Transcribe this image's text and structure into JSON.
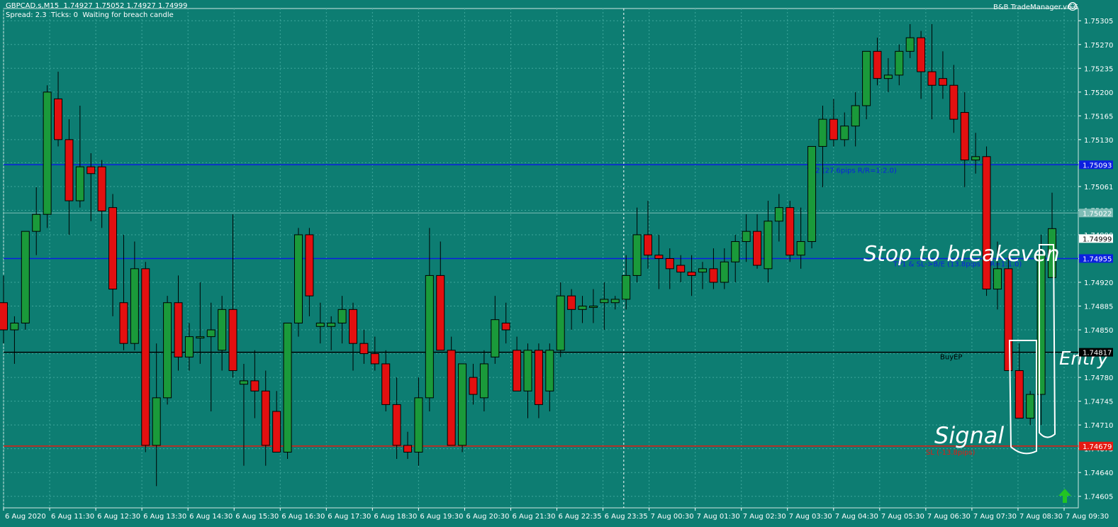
{
  "header": {
    "symbol_line": "GBPCAD.s,M15  1.74927 1.75052 1.74927 1.74999",
    "status_line": "Spread: 2.3  Ticks: 0  Waiting for breach candle",
    "ea_name": "B&B TradeManager.v6.6"
  },
  "colors": {
    "background": "#0d7d72",
    "bull_candle": "#1a9a3a",
    "bear_candle": "#e31010",
    "grid": "#3fa79c",
    "tp_line": "#0b1fe0",
    "sl_line": "#e41a12",
    "entry_line": "#000000",
    "annotation": "#ffffff"
  },
  "chart_data": {
    "type": "candlestick",
    "symbol": "GBPCAD.s",
    "timeframe": "M15",
    "ylim": [
      1.74605,
      1.75305
    ],
    "y_ticks": [
      "1.75305",
      "1.75270",
      "1.75235",
      "1.75200",
      "1.75165",
      "1.75130",
      "1.75096",
      "1.75061",
      "1.75026",
      "1.74990",
      "1.74955",
      "1.74920",
      "1.74885",
      "1.74850",
      "1.74815",
      "1.74780",
      "1.74745",
      "1.74710",
      "1.74675",
      "1.74640",
      "1.74605"
    ],
    "x_ticks": [
      "6 Aug 2020",
      "6 Aug 11:30",
      "6 Aug 12:30",
      "6 Aug 13:30",
      "6 Aug 14:30",
      "6 Aug 15:30",
      "6 Aug 16:30",
      "6 Aug 17:30",
      "6 Aug 18:30",
      "6 Aug 19:30",
      "6 Aug 20:30",
      "6 Aug 21:30",
      "6 Aug 22:35",
      "6 Aug 23:35",
      "7 Aug 00:30",
      "7 Aug 01:30",
      "7 Aug 02:30",
      "7 Aug 03:30",
      "7 Aug 04:30",
      "7 Aug 05:30",
      "7 Aug 06:30",
      "7 Aug 07:30",
      "7 Aug 08:30",
      "7 Aug 09:30"
    ],
    "candles": [
      {
        "o": 1.7489,
        "h": 1.7493,
        "l": 1.7483,
        "c": 1.7485
      },
      {
        "o": 1.7485,
        "h": 1.7487,
        "l": 1.748,
        "c": 1.7486
      },
      {
        "o": 1.7486,
        "h": 1.7495,
        "l": 1.7485,
        "c": 1.74995
      },
      {
        "o": 1.74995,
        "h": 1.7506,
        "l": 1.7496,
        "c": 1.7502
      },
      {
        "o": 1.7502,
        "h": 1.7521,
        "l": 1.75,
        "c": 1.752
      },
      {
        "o": 1.7519,
        "h": 1.7523,
        "l": 1.7512,
        "c": 1.7513
      },
      {
        "o": 1.7513,
        "h": 1.7516,
        "l": 1.7499,
        "c": 1.7504
      },
      {
        "o": 1.7504,
        "h": 1.7518,
        "l": 1.7503,
        "c": 1.7509
      },
      {
        "o": 1.7509,
        "h": 1.7511,
        "l": 1.7501,
        "c": 1.7508
      },
      {
        "o": 1.7509,
        "h": 1.751,
        "l": 1.75,
        "c": 1.75025
      },
      {
        "o": 1.7503,
        "h": 1.7505,
        "l": 1.7487,
        "c": 1.7491
      },
      {
        "o": 1.7489,
        "h": 1.7499,
        "l": 1.7482,
        "c": 1.7483
      },
      {
        "o": 1.7483,
        "h": 1.7498,
        "l": 1.7482,
        "c": 1.7494
      },
      {
        "o": 1.7494,
        "h": 1.7495,
        "l": 1.7467,
        "c": 1.7468
      },
      {
        "o": 1.7468,
        "h": 1.7483,
        "l": 1.7462,
        "c": 1.7475
      },
      {
        "o": 1.7475,
        "h": 1.749,
        "l": 1.7474,
        "c": 1.7489
      },
      {
        "o": 1.7489,
        "h": 1.7493,
        "l": 1.7479,
        "c": 1.7481
      },
      {
        "o": 1.7481,
        "h": 1.7486,
        "l": 1.7479,
        "c": 1.7484
      },
      {
        "o": 1.7484,
        "h": 1.7492,
        "l": 1.748,
        "c": 1.7484
      },
      {
        "o": 1.7484,
        "h": 1.7489,
        "l": 1.7473,
        "c": 1.7485
      },
      {
        "o": 1.7482,
        "h": 1.749,
        "l": 1.7479,
        "c": 1.7488
      },
      {
        "o": 1.7488,
        "h": 1.7502,
        "l": 1.7478,
        "c": 1.7479
      },
      {
        "o": 1.7477,
        "h": 1.748,
        "l": 1.7465,
        "c": 1.74775
      },
      {
        "o": 1.74775,
        "h": 1.7482,
        "l": 1.7472,
        "c": 1.7476
      },
      {
        "o": 1.7476,
        "h": 1.7479,
        "l": 1.7465,
        "c": 1.7468
      },
      {
        "o": 1.7473,
        "h": 1.7476,
        "l": 1.7467,
        "c": 1.7467
      },
      {
        "o": 1.7467,
        "h": 1.7481,
        "l": 1.7466,
        "c": 1.7486
      },
      {
        "o": 1.7486,
        "h": 1.75,
        "l": 1.7484,
        "c": 1.7499
      },
      {
        "o": 1.7499,
        "h": 1.75,
        "l": 1.7487,
        "c": 1.749
      },
      {
        "o": 1.74855,
        "h": 1.7489,
        "l": 1.7483,
        "c": 1.7486
      },
      {
        "o": 1.74855,
        "h": 1.7487,
        "l": 1.7482,
        "c": 1.7486
      },
      {
        "o": 1.7486,
        "h": 1.749,
        "l": 1.7483,
        "c": 1.7488
      },
      {
        "o": 1.7488,
        "h": 1.7489,
        "l": 1.7479,
        "c": 1.7483
      },
      {
        "o": 1.7483,
        "h": 1.7485,
        "l": 1.748,
        "c": 1.74815
      },
      {
        "o": 1.74815,
        "h": 1.7484,
        "l": 1.7479,
        "c": 1.748
      },
      {
        "o": 1.748,
        "h": 1.7482,
        "l": 1.7473,
        "c": 1.7474
      },
      {
        "o": 1.7474,
        "h": 1.7478,
        "l": 1.7466,
        "c": 1.7468
      },
      {
        "o": 1.7468,
        "h": 1.747,
        "l": 1.7466,
        "c": 1.7467
      },
      {
        "o": 1.7467,
        "h": 1.7478,
        "l": 1.7465,
        "c": 1.7475
      },
      {
        "o": 1.7475,
        "h": 1.75,
        "l": 1.7473,
        "c": 1.7493
      },
      {
        "o": 1.7493,
        "h": 1.7498,
        "l": 1.7483,
        "c": 1.7482
      },
      {
        "o": 1.7482,
        "h": 1.7484,
        "l": 1.7468,
        "c": 1.7468
      },
      {
        "o": 1.7468,
        "h": 1.7478,
        "l": 1.7467,
        "c": 1.748
      },
      {
        "o": 1.7478,
        "h": 1.748,
        "l": 1.7474,
        "c": 1.74755
      },
      {
        "o": 1.7475,
        "h": 1.7482,
        "l": 1.7473,
        "c": 1.748
      },
      {
        "o": 1.7481,
        "h": 1.749,
        "l": 1.748,
        "c": 1.74865
      },
      {
        "o": 1.7486,
        "h": 1.7489,
        "l": 1.7483,
        "c": 1.7485
      },
      {
        "o": 1.7482,
        "h": 1.7484,
        "l": 1.7476,
        "c": 1.7476
      },
      {
        "o": 1.7476,
        "h": 1.7483,
        "l": 1.7472,
        "c": 1.7482
      },
      {
        "o": 1.7482,
        "h": 1.7483,
        "l": 1.7472,
        "c": 1.7474
      },
      {
        "o": 1.7476,
        "h": 1.7483,
        "l": 1.7473,
        "c": 1.7482
      },
      {
        "o": 1.7482,
        "h": 1.7492,
        "l": 1.7481,
        "c": 1.749
      },
      {
        "o": 1.749,
        "h": 1.7491,
        "l": 1.7485,
        "c": 1.7488
      },
      {
        "o": 1.7488,
        "h": 1.749,
        "l": 1.7486,
        "c": 1.74885
      },
      {
        "o": 1.74885,
        "h": 1.7491,
        "l": 1.7486,
        "c": 1.74885
      },
      {
        "o": 1.7489,
        "h": 1.7492,
        "l": 1.7485,
        "c": 1.74895
      },
      {
        "o": 1.7489,
        "h": 1.749,
        "l": 1.7488,
        "c": 1.74895
      },
      {
        "o": 1.74895,
        "h": 1.7496,
        "l": 1.7488,
        "c": 1.7493
      },
      {
        "o": 1.7493,
        "h": 1.7503,
        "l": 1.7492,
        "c": 1.7499
      },
      {
        "o": 1.7499,
        "h": 1.7504,
        "l": 1.7494,
        "c": 1.7496
      },
      {
        "o": 1.7496,
        "h": 1.7499,
        "l": 1.7491,
        "c": 1.74955
      },
      {
        "o": 1.74955,
        "h": 1.7497,
        "l": 1.7491,
        "c": 1.7494
      },
      {
        "o": 1.74945,
        "h": 1.7496,
        "l": 1.7492,
        "c": 1.74935
      },
      {
        "o": 1.74935,
        "h": 1.7496,
        "l": 1.749,
        "c": 1.7493
      },
      {
        "o": 1.74935,
        "h": 1.7495,
        "l": 1.7491,
        "c": 1.7494
      },
      {
        "o": 1.7494,
        "h": 1.7497,
        "l": 1.7491,
        "c": 1.7492
      },
      {
        "o": 1.7492,
        "h": 1.7497,
        "l": 1.7491,
        "c": 1.7495
      },
      {
        "o": 1.7495,
        "h": 1.7499,
        "l": 1.7492,
        "c": 1.7498
      },
      {
        "o": 1.7498,
        "h": 1.7502,
        "l": 1.7495,
        "c": 1.74995
      },
      {
        "o": 1.74995,
        "h": 1.7502,
        "l": 1.7494,
        "c": 1.74945
      },
      {
        "o": 1.7494,
        "h": 1.7504,
        "l": 1.7492,
        "c": 1.7501
      },
      {
        "o": 1.7501,
        "h": 1.7505,
        "l": 1.7498,
        "c": 1.7503
      },
      {
        "o": 1.7503,
        "h": 1.7504,
        "l": 1.7495,
        "c": 1.7496
      },
      {
        "o": 1.7496,
        "h": 1.7503,
        "l": 1.7494,
        "c": 1.7498
      },
      {
        "o": 1.7498,
        "h": 1.7504,
        "l": 1.7497,
        "c": 1.7512
      },
      {
        "o": 1.7512,
        "h": 1.7518,
        "l": 1.7506,
        "c": 1.7516
      },
      {
        "o": 1.7516,
        "h": 1.7519,
        "l": 1.7512,
        "c": 1.7513
      },
      {
        "o": 1.7513,
        "h": 1.7517,
        "l": 1.7512,
        "c": 1.7515
      },
      {
        "o": 1.7515,
        "h": 1.752,
        "l": 1.7512,
        "c": 1.7518
      },
      {
        "o": 1.7518,
        "h": 1.7522,
        "l": 1.7516,
        "c": 1.7526
      },
      {
        "o": 1.7526,
        "h": 1.7528,
        "l": 1.7521,
        "c": 1.7522
      },
      {
        "o": 1.7522,
        "h": 1.7525,
        "l": 1.752,
        "c": 1.75225
      },
      {
        "o": 1.75225,
        "h": 1.7527,
        "l": 1.7521,
        "c": 1.7526
      },
      {
        "o": 1.7526,
        "h": 1.753,
        "l": 1.7525,
        "c": 1.7528
      },
      {
        "o": 1.7528,
        "h": 1.7529,
        "l": 1.7519,
        "c": 1.7523
      },
      {
        "o": 1.7523,
        "h": 1.753,
        "l": 1.7516,
        "c": 1.7521
      },
      {
        "o": 1.7522,
        "h": 1.7526,
        "l": 1.7519,
        "c": 1.7521
      },
      {
        "o": 1.7521,
        "h": 1.7524,
        "l": 1.7514,
        "c": 1.7516
      },
      {
        "o": 1.7517,
        "h": 1.752,
        "l": 1.7506,
        "c": 1.751
      },
      {
        "o": 1.751,
        "h": 1.7514,
        "l": 1.7508,
        "c": 1.75105
      },
      {
        "o": 1.75105,
        "h": 1.7512,
        "l": 1.749,
        "c": 1.7491
      },
      {
        "o": 1.7491,
        "h": 1.7498,
        "l": 1.7488,
        "c": 1.7494
      },
      {
        "o": 1.7494,
        "h": 1.7496,
        "l": 1.7479,
        "c": 1.7479
      },
      {
        "o": 1.7479,
        "h": 1.7483,
        "l": 1.7472,
        "c": 1.7472
      },
      {
        "o": 1.7472,
        "h": 1.7476,
        "l": 1.7471,
        "c": 1.74755
      },
      {
        "o": 1.74755,
        "h": 1.7499,
        "l": 1.7471,
        "c": 1.7496
      },
      {
        "o": 1.74927,
        "h": 1.75052,
        "l": 1.74927,
        "c": 1.74999
      }
    ]
  },
  "levels": {
    "tp2": {
      "price": 1.75093,
      "price_label": "1.75093",
      "text": "TP2 (27.6pips R/R=1:2.0)"
    },
    "tp1": {
      "price": 1.74955,
      "price_label": "1.74955",
      "text": "TP1 & SL->B/E (13.8pips R/R=1:1.0)"
    },
    "entry": {
      "price": 1.74817,
      "price_label": "1.74817",
      "text": "BuyEP"
    },
    "sl": {
      "price": 1.74679,
      "price_label": "1.74679",
      "text": "SL (-13.8pips)"
    },
    "ask": {
      "price": 1.75022,
      "price_label": "1.75022"
    },
    "bid": {
      "price": 1.74999,
      "price_label": "1.74999"
    }
  },
  "annotations": {
    "stop_to_breakeven": "Stop to breakeven",
    "signal": "Signal",
    "entry": "Entry"
  }
}
